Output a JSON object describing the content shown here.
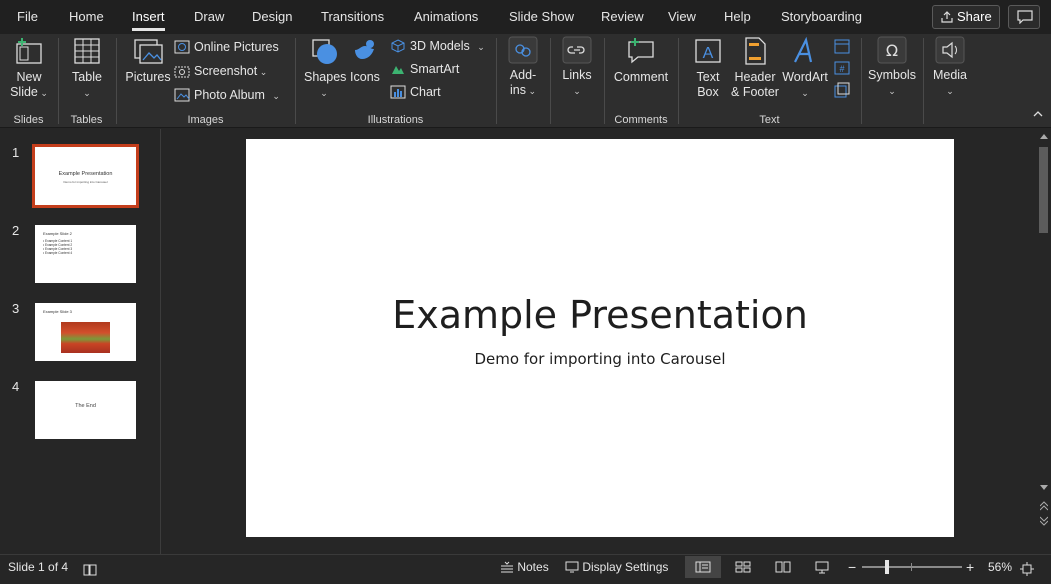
{
  "tabs": [
    {
      "label": "File",
      "active": false
    },
    {
      "label": "Home",
      "active": false
    },
    {
      "label": "Insert",
      "active": true
    },
    {
      "label": "Draw",
      "active": false
    },
    {
      "label": "Design",
      "active": false
    },
    {
      "label": "Transitions",
      "active": false
    },
    {
      "label": "Animations",
      "active": false
    },
    {
      "label": "Slide Show",
      "active": false
    },
    {
      "label": "Review",
      "active": false
    },
    {
      "label": "View",
      "active": false
    },
    {
      "label": "Help",
      "active": false
    },
    {
      "label": "Storyboarding",
      "active": false
    }
  ],
  "share_label": "Share",
  "ribbon": {
    "slides": {
      "group": "Slides",
      "new_slide_line1": "New",
      "new_slide_line2": "Slide"
    },
    "tables": {
      "group": "Tables",
      "table": "Table"
    },
    "images": {
      "group": "Images",
      "pictures": "Pictures",
      "online_pictures": "Online Pictures",
      "screenshot": "Screenshot",
      "photo_album": "Photo Album"
    },
    "illustrations": {
      "group": "Illustrations",
      "shapes": "Shapes",
      "icons": "Icons",
      "models_3d": "3D Models",
      "smartart": "SmartArt",
      "chart": "Chart"
    },
    "addins": {
      "line1": "Add-",
      "line2": "ins"
    },
    "links": {
      "label": "Links"
    },
    "comments": {
      "group": "Comments",
      "comment": "Comment"
    },
    "text": {
      "group": "Text",
      "textbox_line1": "Text",
      "textbox_line2": "Box",
      "header_line1": "Header",
      "header_line2": "& Footer",
      "wordart": "WordArt"
    },
    "symbols": {
      "label": "Symbols"
    },
    "media": {
      "label": "Media"
    }
  },
  "thumbnails": [
    {
      "number": "1",
      "title": "Example Presentation",
      "subtitle": "Demo for importing into Carousel"
    },
    {
      "number": "2",
      "title": "Example Slide 2",
      "bullets": [
        "Example Content 1",
        "Example Content 2",
        "Example Content 3",
        "Example Content 4"
      ]
    },
    {
      "number": "3",
      "title": "Example Slide 3"
    },
    {
      "number": "4",
      "title": "The End"
    }
  ],
  "slide": {
    "title": "Example Presentation",
    "subtitle": "Demo for importing into Carousel"
  },
  "status": {
    "slide_info": "Slide 1 of 4",
    "notes": "Notes",
    "display_settings": "Display Settings",
    "zoom": "56%",
    "zoom_level": 0.56
  },
  "colors": {
    "accent": "#c43e1c",
    "icon_blue": "#4a90e2",
    "icon_green": "#3cb371"
  }
}
